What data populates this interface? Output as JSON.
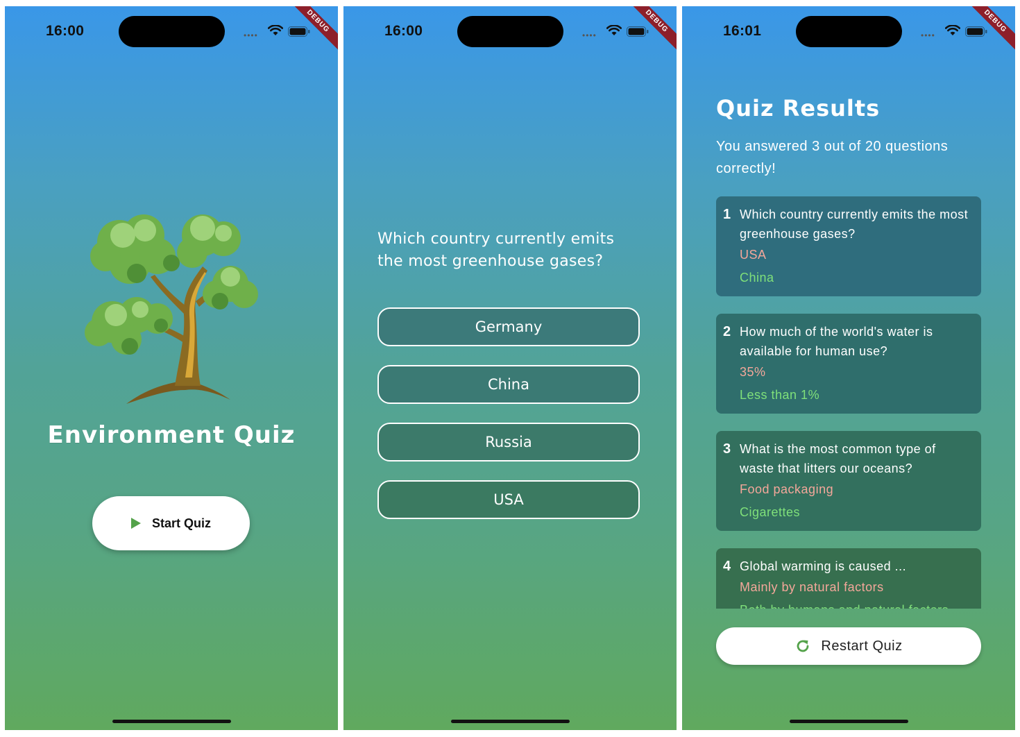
{
  "screens": [
    {
      "status_time": "16:00",
      "debug_label": "DEBUG",
      "title": "Environment Quiz",
      "start_button_label": "Start Quiz"
    },
    {
      "status_time": "16:00",
      "debug_label": "DEBUG",
      "question": "Which country currently emits the most greenhouse gases?",
      "answers": [
        "Germany",
        "China",
        "Russia",
        "USA"
      ]
    },
    {
      "status_time": "16:01",
      "debug_label": "DEBUG",
      "title": "Quiz Results",
      "summary": "You answered 3 out of 20 questions correctly!",
      "results": [
        {
          "number": "1",
          "question": "Which country currently emits the most greenhouse gases?",
          "user_answer": "USA",
          "correct_answer": "China"
        },
        {
          "number": "2",
          "question": "How much of the world's water is available for human use?",
          "user_answer": "35%",
          "correct_answer": "Less than 1%"
        },
        {
          "number": "3",
          "question": "What is the most common type of waste that litters our oceans?",
          "user_answer": "Food packaging",
          "correct_answer": "Cigarettes"
        },
        {
          "number": "4",
          "question": "Global warming is caused ...",
          "user_answer": "Mainly by natural factors",
          "correct_answer": "Both by humans and natural factors"
        }
      ],
      "restart_button_label": "Restart Quiz"
    }
  ],
  "colors": {
    "gradient_top": "#3a97e8",
    "gradient_bottom": "#60a95e",
    "wrong_answer": "#f4a79a",
    "correct_answer": "#7fe07a",
    "accent_green": "#54a24a",
    "debug_ribbon": "#8d1f2a"
  },
  "icons": {
    "status": [
      "signal-dots-icon",
      "wifi-icon",
      "battery-icon"
    ],
    "start": "play-icon",
    "restart": "refresh-icon",
    "illustration": "tree-icon"
  }
}
